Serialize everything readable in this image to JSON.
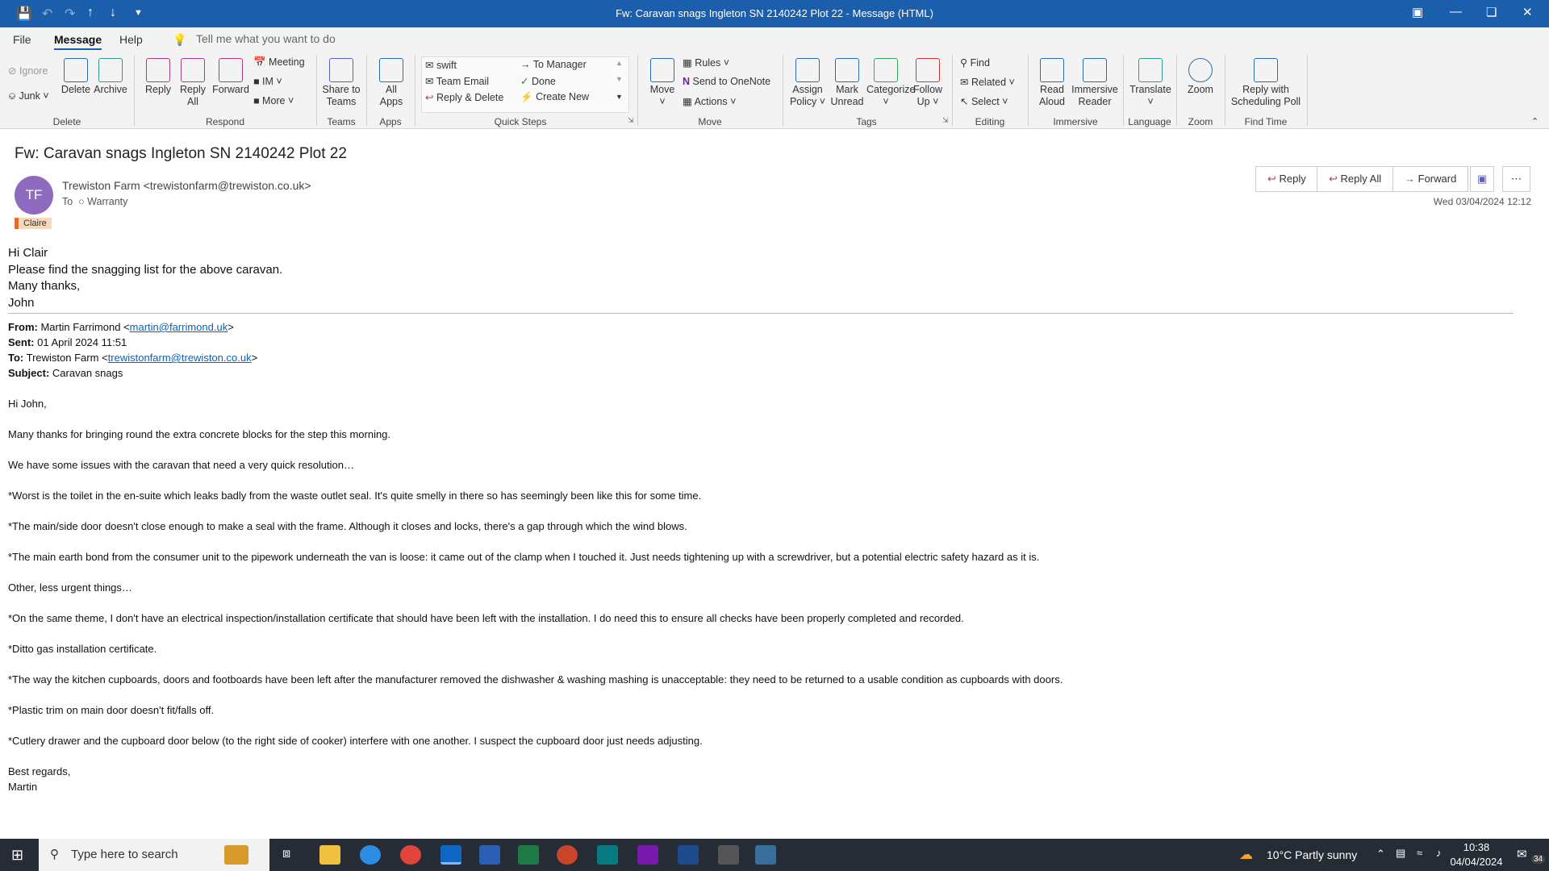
{
  "window": {
    "title": "Fw: Caravan snags Ingleton SN 2140242 Plot 22  -  Message (HTML)"
  },
  "menu": {
    "items": [
      "File",
      "Message",
      "Help"
    ],
    "tell_me": "Tell me what you want to do"
  },
  "ribbon": {
    "delete": {
      "ignore": "Ignore",
      "junk": "Junk",
      "delete": "Delete",
      "archive": "Archive",
      "group": "Delete"
    },
    "respond": {
      "reply": "Reply",
      "reply_all_1": "Reply",
      "reply_all_2": "All",
      "forward": "Forward",
      "meeting": "Meeting",
      "im": "IM",
      "more": "More",
      "group": "Respond"
    },
    "teams": {
      "share_1": "Share to",
      "share_2": "Teams",
      "group": "Teams"
    },
    "apps": {
      "all_1": "All",
      "all_2": "Apps",
      "group": "Apps"
    },
    "quick_steps": {
      "items": [
        "swift",
        "To Manager",
        "Team Email",
        "Done",
        "Reply & Delete",
        "Create New"
      ],
      "group": "Quick Steps"
    },
    "move": {
      "move": "Move",
      "rules": "Rules",
      "onenote": "Send to OneNote",
      "actions": "Actions",
      "group": "Move"
    },
    "tags": {
      "assign_1": "Assign",
      "assign_2": "Policy",
      "mark_1": "Mark",
      "mark_2": "Unread",
      "categorize": "Categorize",
      "follow_1": "Follow",
      "follow_2": "Up",
      "group": "Tags"
    },
    "editing": {
      "find": "Find",
      "related": "Related",
      "select": "Select",
      "group": "Editing"
    },
    "immersive": {
      "read_1": "Read",
      "read_2": "Aloud",
      "reader_1": "Immersive",
      "reader_2": "Reader",
      "group": "Immersive"
    },
    "language": {
      "translate": "Translate",
      "group": "Language"
    },
    "zoom": {
      "zoom": "Zoom",
      "group": "Zoom"
    },
    "find_time": {
      "poll_1": "Reply with",
      "poll_2": "Scheduling Poll",
      "group": "Find Time"
    }
  },
  "message": {
    "subject": "Fw: Caravan snags Ingleton SN 2140242 Plot 22",
    "avatar_initials": "TF",
    "sender": "Trewiston Farm <trewistonfarm@trewiston.co.uk>",
    "to_label": "To",
    "to_value": "Warranty",
    "category": "Claire",
    "actions": {
      "reply": "Reply",
      "reply_all": "Reply All",
      "forward": "Forward"
    },
    "date": "Wed 03/04/2024 12:12",
    "greeting": [
      "Hi Clair",
      "Please find the snagging list for the above caravan.",
      "Many thanks,",
      "John"
    ],
    "forwarded": {
      "from_label": "From:",
      "from_name": "Martin Farrimond <",
      "from_email": "martin@farrimond.uk",
      "sent_label": "Sent:",
      "sent_value": "01 April 2024 11:51",
      "to_label": "To:",
      "to_name": "Trewiston Farm <",
      "to_email": "trewistonfarm@trewiston.co.uk",
      "subject_label": "Subject:",
      "subject_value": "Caravan snags",
      "paragraphs": [
        "Hi John,",
        "Many thanks for bringing round the extra concrete blocks for the step this morning.",
        "We have some issues with the caravan that need a very quick resolution…",
        "*Worst is the toilet in the en-suite which leaks badly from the waste outlet seal. It's quite smelly in there so has seemingly been like this for some time.",
        "*The main/side door doesn't close enough to make a seal with the frame. Although it closes and locks, there's a gap through which the wind blows.",
        "*The main earth bond from the consumer unit to the pipework underneath the van is loose: it came out of the clamp when I touched it. Just needs tightening up with a screwdriver, but a potential electric safety hazard as it is.",
        "Other, less urgent things…",
        "*On the same theme, I don't have an electrical inspection/installation certificate that should have been left with the installation. I do need this to ensure all checks have been properly completed and recorded.",
        "*Ditto gas installation certificate.",
        "*The way the kitchen cupboards, doors and footboards have been left after the manufacturer removed the dishwasher & washing mashing is unacceptable: they need to be returned to a usable condition as cupboards with doors.",
        "*Plastic trim on main door doesn't fit/falls off.",
        "*Cutlery drawer and the cupboard door below (to the right side of cooker) interfere with one another. I suspect the cupboard door just needs adjusting."
      ],
      "closing": [
        "Best regards,",
        "Martin"
      ]
    }
  },
  "taskbar": {
    "search_placeholder": "Type here to search",
    "weather": "10°C  Partly sunny",
    "time": "10:38",
    "date": "04/04/2024",
    "notifications": "34"
  }
}
